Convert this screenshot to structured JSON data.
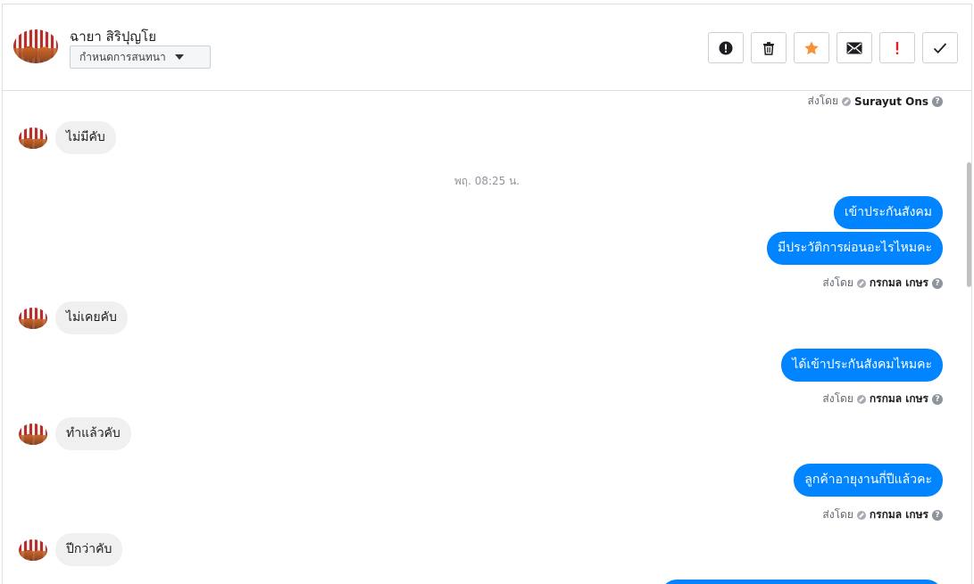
{
  "header": {
    "contact_name": "ฉายา สิริปุญโย",
    "status_select": "กำหนดการสนทนา",
    "actions": [
      {
        "icon": "alert-circle-icon"
      },
      {
        "icon": "trash-icon"
      },
      {
        "icon": "star-icon"
      },
      {
        "icon": "envelope-icon"
      },
      {
        "icon": "exclamation-icon"
      },
      {
        "icon": "check-icon"
      }
    ]
  },
  "conversation": {
    "sent_by_label": "ส่งโดย",
    "sent_by_1": "Surayut Ons",
    "in_1": "ไม่มีคับ",
    "timestamp_1": "พฤ. 08:25 น.",
    "out_1": "เข้าประกันสังคม",
    "out_2": "มีประวัติการผ่อนอะไรไหมคะ",
    "sent_by_2": "กรกมล เกษร",
    "in_2": "ไม่เคยคับ",
    "out_3": "ได้เข้าประกันสังคมไหมคะ",
    "sent_by_3": "กรกมล เกษร",
    "in_3": "ทำแล้วคับ",
    "out_4": "ลูกค้าอายุงานกี่ปีแล้วคะ",
    "sent_by_4": "กรกมล เกษร",
    "in_4": "ปีกว่าคับ",
    "help_glyph": "?"
  },
  "colors": {
    "accent": "#0084ff",
    "incoming_bubble": "#f1f0f0",
    "star": "#f7923a",
    "flag": "#e02020"
  }
}
